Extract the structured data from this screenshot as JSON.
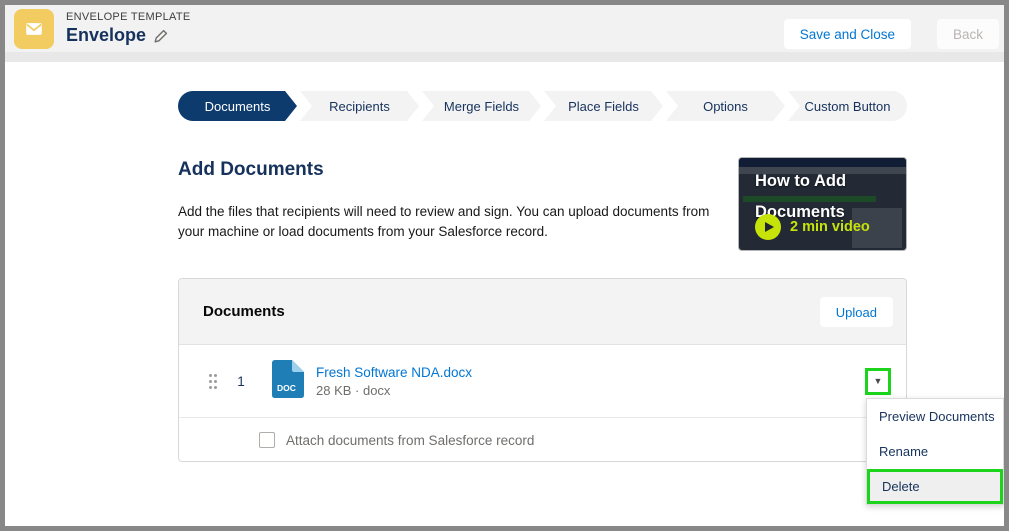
{
  "header": {
    "eyebrow": "ENVELOPE TEMPLATE",
    "title": "Envelope",
    "icon_bg": "#F2CB61",
    "buttons": {
      "save_and_close": "Save and Close",
      "back": "Back"
    }
  },
  "path": {
    "steps": [
      {
        "label": "Documents",
        "active": true
      },
      {
        "label": "Recipients",
        "active": false
      },
      {
        "label": "Merge Fields",
        "active": false
      },
      {
        "label": "Place Fields",
        "active": false
      },
      {
        "label": "Options",
        "active": false
      },
      {
        "label": "Custom Button",
        "active": false
      }
    ]
  },
  "intro": {
    "heading": "Add Documents",
    "description": "Add the files that recipients will need to review and sign. You can upload documents from your machine or load documents from your Salesforce record."
  },
  "video": {
    "title_line1": "How to Add",
    "title_line2": "Documents",
    "duration_label": "2 min video",
    "accent_color": "#C6E40A"
  },
  "documents_card": {
    "title": "Documents",
    "upload_button": "Upload",
    "document": {
      "order": "1",
      "name": "Fresh Software NDA.docx",
      "meta": "28 KB · docx",
      "type_badge": "DOC"
    },
    "attach_label": "Attach documents from Salesforce record",
    "attach_checked": false
  },
  "document_menu": {
    "items": [
      {
        "label": "Preview Documents",
        "highlighted": false
      },
      {
        "label": "Rename",
        "highlighted": false
      },
      {
        "label": "Delete",
        "highlighted": true
      }
    ]
  },
  "annotation": {
    "highlight_color": "#1BD41B"
  },
  "colors": {
    "navy": "#16325C",
    "active_step_bg": "#0D3B6E",
    "link_blue": "#0176D3",
    "muted_text": "#706E6B",
    "header_bg": "#F2F2F2",
    "doc_icon_blue": "#1F7EB5"
  }
}
